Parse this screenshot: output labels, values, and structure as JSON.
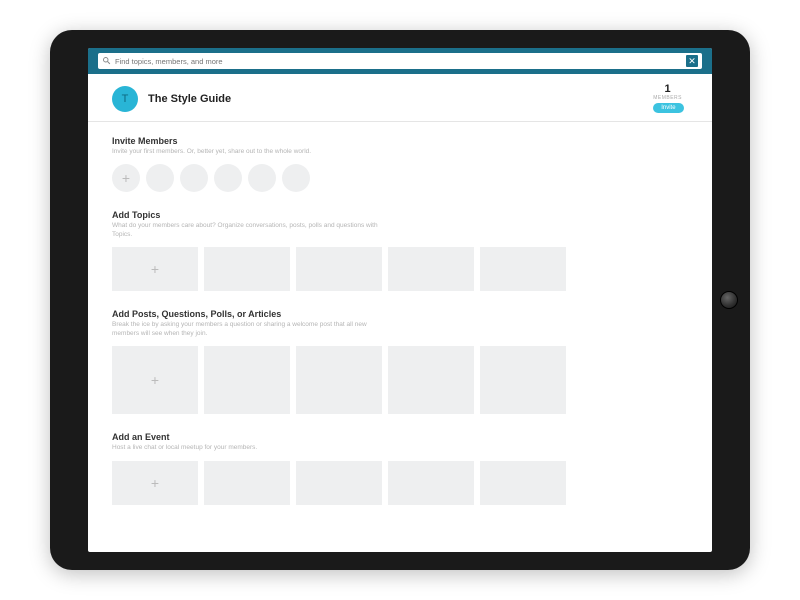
{
  "search": {
    "placeholder": "Find topics, members, and more"
  },
  "header": {
    "avatar_letter": "T",
    "title": "The Style Guide",
    "member_count": "1",
    "member_label": "MEMBERS",
    "invite_label": "Invite"
  },
  "sections": {
    "invite": {
      "title": "Invite Members",
      "sub": "Invite your first members. Or, better yet, share out to the whole world."
    },
    "topics": {
      "title": "Add Topics",
      "sub": "What do your members care about? Organize conversations, posts, polls and questions with Topics."
    },
    "posts": {
      "title": "Add Posts, Questions, Polls, or Articles",
      "sub": "Break the ice by asking your members a question or sharing a welcome post that all new members will see when they join."
    },
    "events": {
      "title": "Add an Event",
      "sub": "Host a live chat or local meetup for your members."
    }
  }
}
